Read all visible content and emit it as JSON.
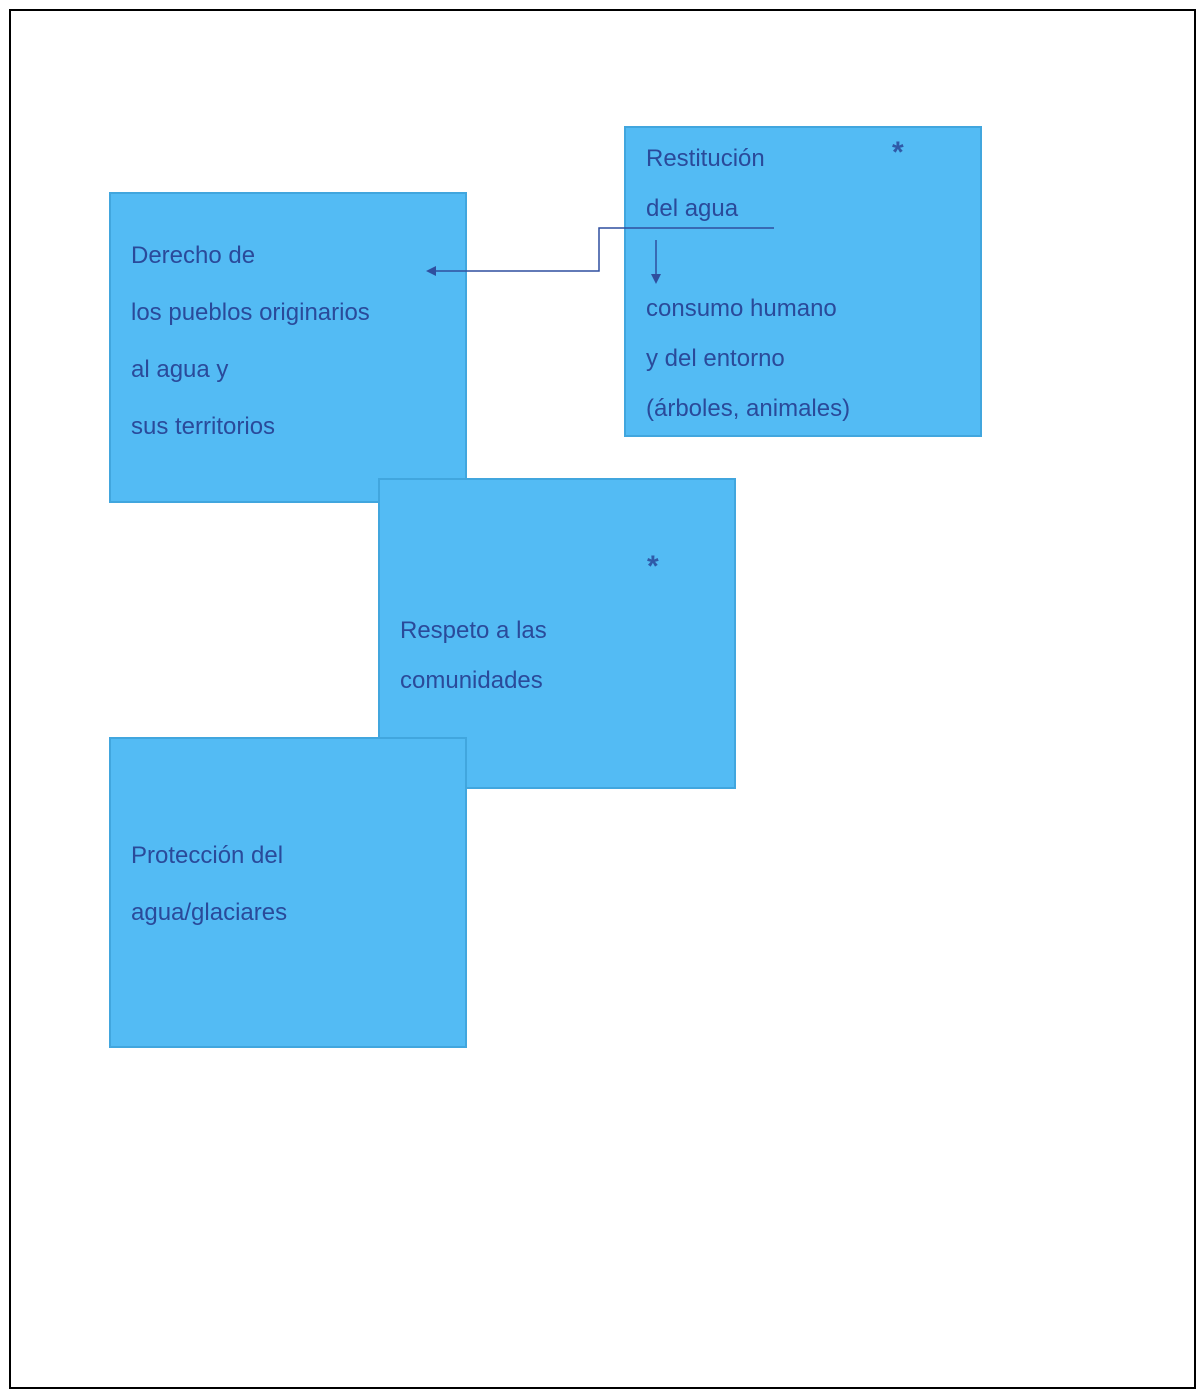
{
  "diagram": {
    "notes": {
      "derecho": {
        "lines": [
          "Derecho de",
          "los pueblos originarios",
          "al agua y",
          "sus territorios"
        ]
      },
      "restitucion": {
        "lines": [
          "Restitución",
          "del agua",
          "",
          "consumo humano",
          "y del entorno",
          "(árboles, animales)"
        ]
      },
      "respeto": {
        "lines": [
          "Respeto a las",
          "comunidades"
        ]
      },
      "proteccion": {
        "lines": [
          "Protección del",
          "agua/glaciares"
        ]
      }
    },
    "markers": {
      "star": "*"
    },
    "colors": {
      "note_fill": "#53bbf4",
      "note_border": "#41a6de",
      "text": "#2a4a9a",
      "connector": "#2f4f9f"
    }
  }
}
